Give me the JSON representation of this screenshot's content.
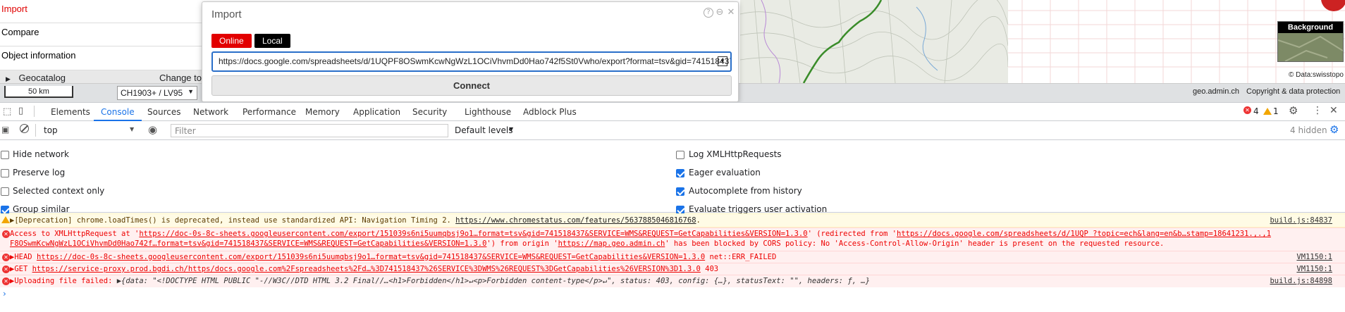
{
  "left_panel": {
    "items": [
      {
        "label": "Import",
        "red": true
      },
      {
        "label": "Compare",
        "red": false
      },
      {
        "label": "Object information",
        "red": false
      }
    ],
    "catalog_label": "Geocatalog",
    "change_label": "Change to"
  },
  "map": {
    "background_title": "Background",
    "data_credit": "© Data:swisstopo",
    "scale_label": "50 km",
    "crs_value": "CH1903+ / LV95",
    "geo_link": "geo.admin.ch",
    "copyright_link": "Copyright & data protection"
  },
  "dialog": {
    "title": "Import",
    "tab_online": "Online",
    "tab_local": "Local",
    "url_value": "https://docs.google.com/spreadsheets/d/1UQPF8OSwmKcwNgWzL1OCiVhvmDd0Hao742f5St0Vwho/export?format=tsv&gid=741518437",
    "connect_label": "Connect",
    "colors": {
      "online": "#e20000",
      "local": "#000000",
      "border": "#2a6fc9"
    }
  },
  "devtools": {
    "tabs": [
      "Elements",
      "Console",
      "Sources",
      "Network",
      "Performance",
      "Memory",
      "Application",
      "Security",
      "Lighthouse",
      "Adblock Plus"
    ],
    "active_tab": "Console",
    "error_count": "4",
    "warning_count": "1",
    "context": "top",
    "filter_placeholder": "Filter",
    "levels": "Default levels",
    "hidden": "4 hidden",
    "settings_left": [
      {
        "label": "Hide network",
        "checked": false
      },
      {
        "label": "Preserve log",
        "checked": false
      },
      {
        "label": "Selected context only",
        "checked": false
      },
      {
        "label": "Group similar",
        "checked": true
      }
    ],
    "settings_right": [
      {
        "label": "Log XMLHttpRequests",
        "checked": false
      },
      {
        "label": "Eager evaluation",
        "checked": true
      },
      {
        "label": "Autocomplete from history",
        "checked": true
      },
      {
        "label": "Evaluate triggers user activation",
        "checked": true
      }
    ]
  },
  "console": {
    "warn": {
      "prefix": "▶[Deprecation] chrome.loadTimes() is deprecated, instead use standardized API: Navigation Timing 2. ",
      "link": "https://www.chromestatus.com/features/5637885046816768",
      "suffix": ".",
      "source": "build.js:84837"
    },
    "cors": {
      "line1_a": "Access to XMLHttpRequest at '",
      "line1_link": "https://doc-0s-8c-sheets.googleusercontent.com/export/151039s6ni5uumqbsj9o1…format=tsv&gid=741518437&SERVICE=WMS&REQUEST=GetCapabilities&VERSION=1.3.0",
      "line1_b": "' (redirected from '",
      "line1_link2": "https://docs.google.com/spreadsheets/d/1UQP",
      "line1_c": " ?topic=ech&lang=en&b…stamp=18641231.,.,1",
      "line2_link": "F8OSwmKcwNgWzL1OCiVhvmDd0Hao742f…format=tsv&gid=741518437&SERVICE=WMS&REQUEST=GetCapabilities&VERSION=1.3.0",
      "line2_b": "') from origin '",
      "line2_link2": "https://map.geo.admin.ch",
      "line2_c": "' has been blocked by CORS policy: No 'Access-Control-Allow-Origin' header is present on the requested resource."
    },
    "head": {
      "prefix": "▶HEAD ",
      "link": "https://doc-0s-8c-sheets.googleusercontent.com/export/151039s6ni5uumqbsj9o1…format=tsv&gid=741518437&SERVICE=WMS&REQUEST=GetCapabilities&VERSION=1.3.0",
      "suffix": " net::ERR_FAILED",
      "source": "VM1150:1"
    },
    "get": {
      "prefix": "▶GET ",
      "link": "https://service-proxy.prod.bgdi.ch/https/docs.google.com%2Fspreadsheets%2Fd…%3D741518437%26SERVICE%3DWMS%26REQUEST%3DGetCapabilities%26VERSION%3D1.3.0",
      "suffix": " 403",
      "source": "VM1150:1"
    },
    "upload": {
      "prefix": "▶Uploading file failed:  ",
      "obj": "▶{data: \"<!DOCTYPE HTML PUBLIC \"-//W3C//DTD HTML 3.2 Final//…<h1>Forbidden</h1>↵<p>Forbidden content-type</p>↵\", status: 403, config: {…}, statusText: \"\", headers: ƒ, …}",
      "source": "build.js:84898"
    }
  }
}
